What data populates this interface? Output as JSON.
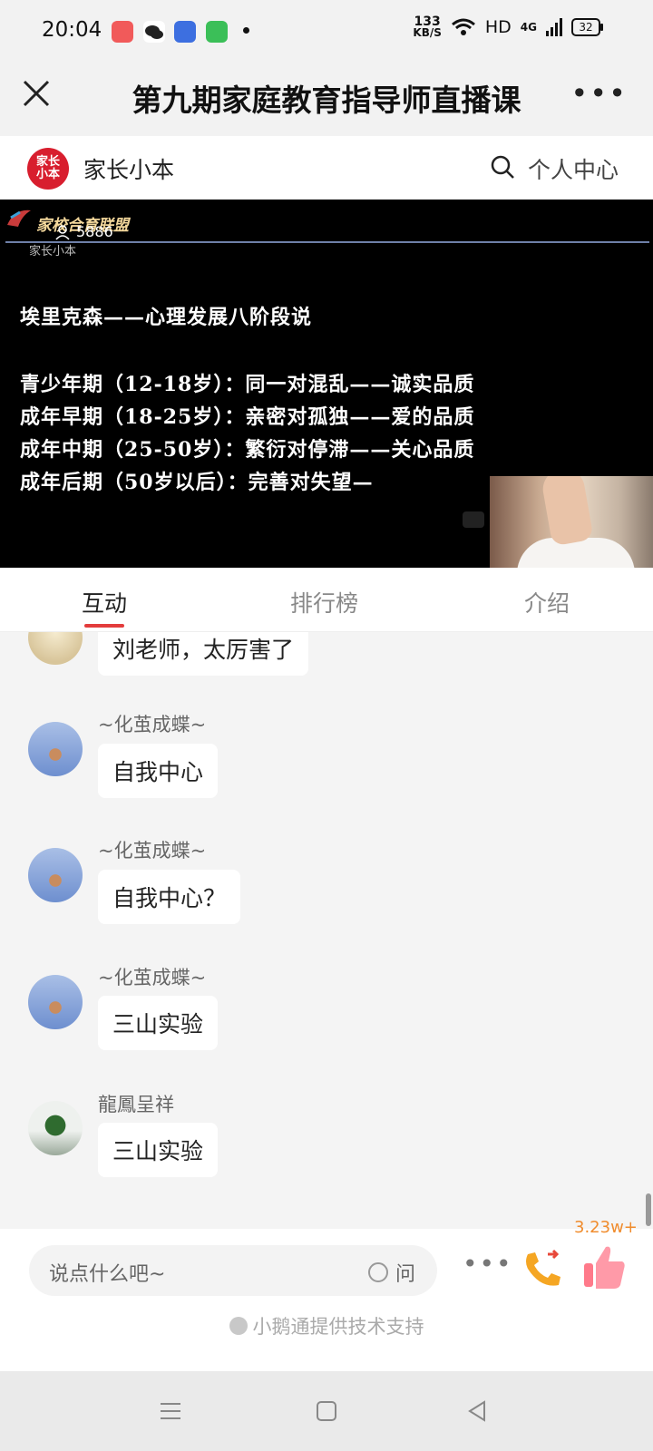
{
  "status_bar": {
    "time": "20:04",
    "speed_value": "133",
    "speed_unit": "KB/S",
    "hd": "HD",
    "network": "4G",
    "battery": "32",
    "app_icons": [
      "app-icon-pink",
      "wechat-icon",
      "baidu-icon",
      "green-app-icon"
    ]
  },
  "title_bar": {
    "title": "第九期家庭教育指导师直播课"
  },
  "site_header": {
    "logo_text": "家长小本",
    "name": "家长小本",
    "personal_center": "个人中心"
  },
  "video": {
    "brand": "家校合育联盟",
    "viewer_count": "5886",
    "sub_label": "家长小本",
    "slide_title": "埃里克森——心理发展八阶段说",
    "slide_lines": [
      "青少年期（12-18岁）：同一对混乱——诚实品质",
      "成年早期（18-25岁）：亲密对孤独——爱的品质",
      "成年中期（25-50岁）：繁衍对停滞——关心品质",
      "成年后期（50岁以后）：完善对失望—"
    ]
  },
  "tabs": [
    {
      "label": "互动",
      "active": true
    },
    {
      "label": "排行榜",
      "active": false
    },
    {
      "label": "介绍",
      "active": false
    }
  ],
  "messages": [
    {
      "user": "",
      "text": "刘老师，太厉害了",
      "avatar": "moon"
    },
    {
      "user": "~化茧成蝶~",
      "text": "自我中心",
      "avatar": "sky"
    },
    {
      "user": "~化茧成蝶~",
      "text": "自我中心？",
      "avatar": "sky"
    },
    {
      "user": "~化茧成蝶~",
      "text": "三山实验",
      "avatar": "sky"
    },
    {
      "user": "龍鳳呈祥",
      "text": "三山实验",
      "avatar": "tree"
    }
  ],
  "bottom_bar": {
    "input_placeholder": "说点什么吧~",
    "ask_label": "问",
    "like_count": "3.23w+",
    "support_text": "小鹅通提供技术支持"
  },
  "colors": {
    "accent": "#e33c3c",
    "like": "#f08c2d",
    "logo_red": "#d81e2e"
  }
}
